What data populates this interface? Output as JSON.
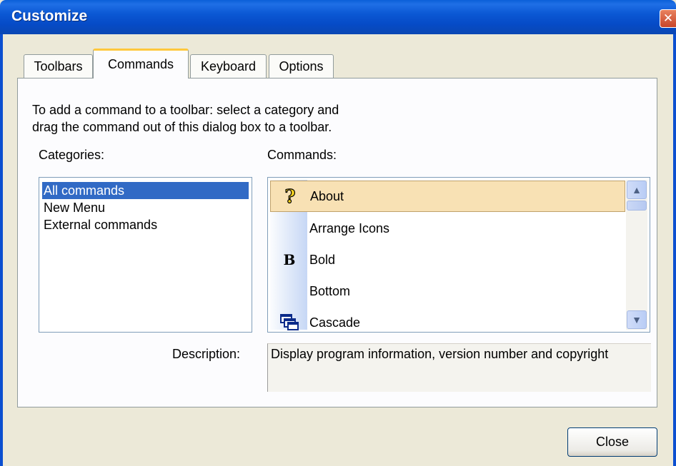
{
  "window": {
    "title": "Customize",
    "close_glyph": "✕"
  },
  "tabs": [
    {
      "label": "Toolbars",
      "active": false
    },
    {
      "label": "Commands",
      "active": true
    },
    {
      "label": "Keyboard",
      "active": false
    },
    {
      "label": "Options",
      "active": false
    }
  ],
  "instructions": {
    "line1": "To add a command to a toolbar: select a category and",
    "line2": "drag the command out of this dialog box to a toolbar."
  },
  "categories": {
    "label": "Categories:",
    "items": [
      "All commands",
      "New Menu",
      "External commands"
    ],
    "selected": "All commands"
  },
  "commands": {
    "label": "Commands:",
    "items": [
      {
        "label": "About",
        "icon": "help-question-icon",
        "glyph": "?"
      },
      {
        "label": "Arrange Icons",
        "icon": "",
        "glyph": ""
      },
      {
        "label": "Bold",
        "icon": "bold-icon",
        "glyph": "B"
      },
      {
        "label": "Bottom",
        "icon": "",
        "glyph": ""
      },
      {
        "label": "Cascade",
        "icon": "cascade-windows-icon",
        "glyph": ""
      }
    ],
    "selected": "About"
  },
  "description": {
    "label": "Description:",
    "text": "Display program information, version number and copyright"
  },
  "buttons": {
    "close": "Close"
  },
  "colors": {
    "titlebar": "#0b58d4",
    "selection": "#316ac5",
    "hover_item": "#f8e1b4",
    "tab_highlight": "#ffc83c",
    "dialog_bg": "#ece9d8"
  }
}
